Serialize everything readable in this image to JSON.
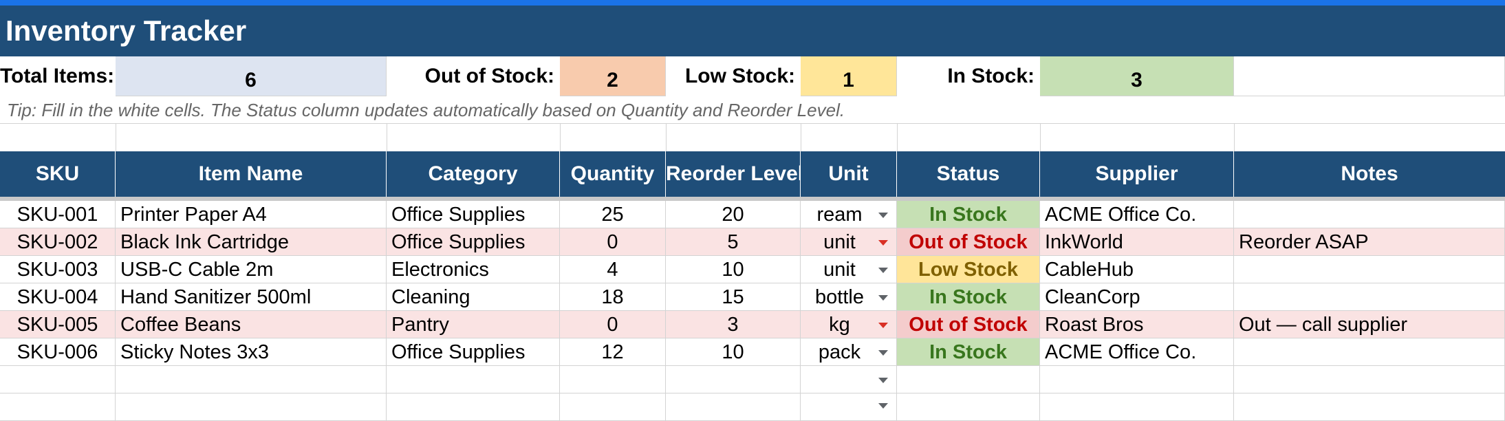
{
  "title": "Inventory Tracker",
  "summary": {
    "total_label": "Total Items:",
    "total_value": "6",
    "out_label": "Out of Stock:",
    "out_value": "2",
    "low_label": "Low Stock:",
    "low_value": "1",
    "in_label": "In Stock:",
    "in_value": "3"
  },
  "colors": {
    "header_bg": "#1f4e79",
    "total_bg": "#dde4f1",
    "out_bg": "#f8cbad",
    "low_bg": "#ffe699",
    "in_bg": "#c6e0b4",
    "out_row_bg": "#fae3e3"
  },
  "tip": "Tip: Fill in the white cells. The Status column updates automatically based on Quantity and Reorder Level.",
  "columns": [
    "SKU",
    "Item Name",
    "Category",
    "Quantity",
    "Reorder Level",
    "Unit",
    "Status",
    "Supplier",
    "Notes"
  ],
  "rows": [
    {
      "sku": "SKU-001",
      "name": "Printer Paper A4",
      "category": "Office Supplies",
      "quantity": "25",
      "reorder": "20",
      "unit": "ream",
      "status": "In Stock",
      "supplier": "ACME Office Co.",
      "notes": ""
    },
    {
      "sku": "SKU-002",
      "name": "Black Ink Cartridge",
      "category": "Office Supplies",
      "quantity": "0",
      "reorder": "5",
      "unit": "unit",
      "status": "Out of Stock",
      "supplier": "InkWorld",
      "notes": "Reorder ASAP"
    },
    {
      "sku": "SKU-003",
      "name": "USB-C Cable 2m",
      "category": "Electronics",
      "quantity": "4",
      "reorder": "10",
      "unit": "unit",
      "status": "Low Stock",
      "supplier": "CableHub",
      "notes": ""
    },
    {
      "sku": "SKU-004",
      "name": "Hand Sanitizer 500ml",
      "category": "Cleaning",
      "quantity": "18",
      "reorder": "15",
      "unit": "bottle",
      "status": "In Stock",
      "supplier": "CleanCorp",
      "notes": ""
    },
    {
      "sku": "SKU-005",
      "name": "Coffee Beans",
      "category": "Pantry",
      "quantity": "0",
      "reorder": "3",
      "unit": "kg",
      "status": "Out of Stock",
      "supplier": "Roast Bros",
      "notes": "Out — call supplier"
    },
    {
      "sku": "SKU-006",
      "name": "Sticky Notes 3x3",
      "category": "Office Supplies",
      "quantity": "12",
      "reorder": "10",
      "unit": "pack",
      "status": "In Stock",
      "supplier": "ACME Office Co.",
      "notes": ""
    }
  ]
}
